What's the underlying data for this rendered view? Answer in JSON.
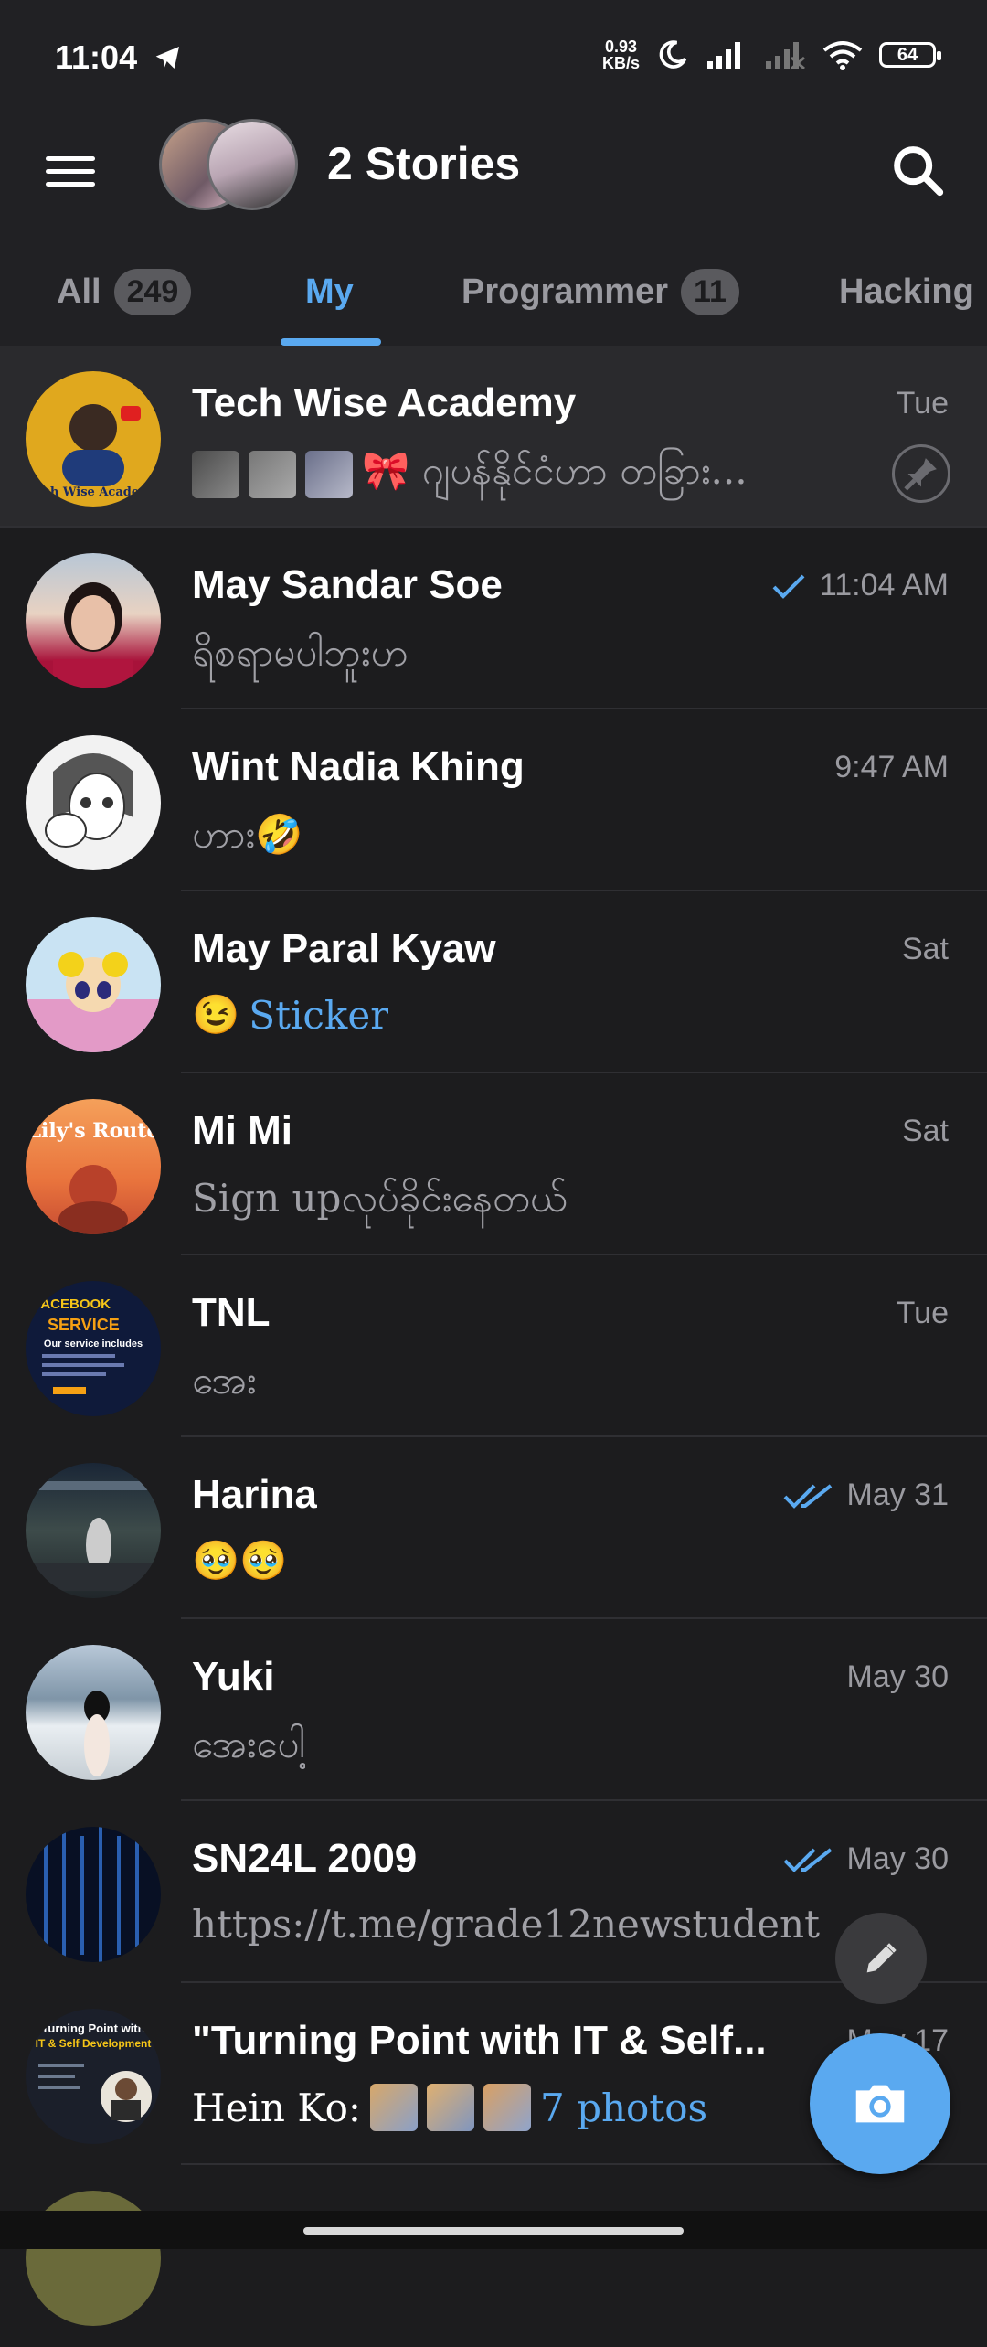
{
  "status": {
    "time": "11:04",
    "net_speed_value": "0.93",
    "net_speed_unit": "KB/s",
    "battery": "64"
  },
  "header": {
    "title": "2 Stories"
  },
  "tabs": [
    {
      "label": "All",
      "badge": "249"
    },
    {
      "label": "My"
    },
    {
      "label": "Programmer",
      "badge": "11"
    },
    {
      "label": "Hacking"
    }
  ],
  "chats": [
    {
      "name": "Tech Wise Academy",
      "time": "Tue",
      "message": "🎀 ဂျပန်နိုင်ငံဟာ တခြား...",
      "pinned": true
    },
    {
      "name": "May Sandar Soe",
      "time": "11:04 AM",
      "message": "ရိစရာမပါဘူးဟ",
      "read": "single"
    },
    {
      "name": "Wint Nadia Khing",
      "time": "9:47 AM",
      "message": "ဟား🤣"
    },
    {
      "name": "May Paral Kyaw",
      "time": "Sat",
      "message_emoji": "😉",
      "message_highlight": "Sticker"
    },
    {
      "name": "Mi Mi",
      "time": "Sat",
      "message": "Sign upလုပ်ခိုင်းနေတယ်"
    },
    {
      "name": "TNL",
      "time": "Tue",
      "message": "အေး"
    },
    {
      "name": "Harina",
      "time": "May 31",
      "message": "🥹🥹",
      "read": "double"
    },
    {
      "name": "Yuki",
      "time": "May 30",
      "message": "အေးပေါ့"
    },
    {
      "name": "SN24L 2009",
      "time": "May 30",
      "message": "https://t.me/grade12newstudent",
      "read": "double"
    },
    {
      "name": "\"Turning Point with IT & Self...",
      "time": "May 17",
      "message_sender": "Hein Ko:",
      "message_highlight": "7 photos"
    }
  ],
  "avatar_texts": {
    "tech_wise": "Tech Wise Academy",
    "lily": "Lily's Route",
    "tnl_line1": "FACEBOOK",
    "tnl_line2": "SERVICE",
    "tnl_line3": "Our service includes",
    "turning_line1": "Turning Point with",
    "turning_line2": "IT & Self Development"
  },
  "colors": {
    "accent": "#5aa9f0",
    "background": "#1c1c1e",
    "header": "#212124"
  }
}
